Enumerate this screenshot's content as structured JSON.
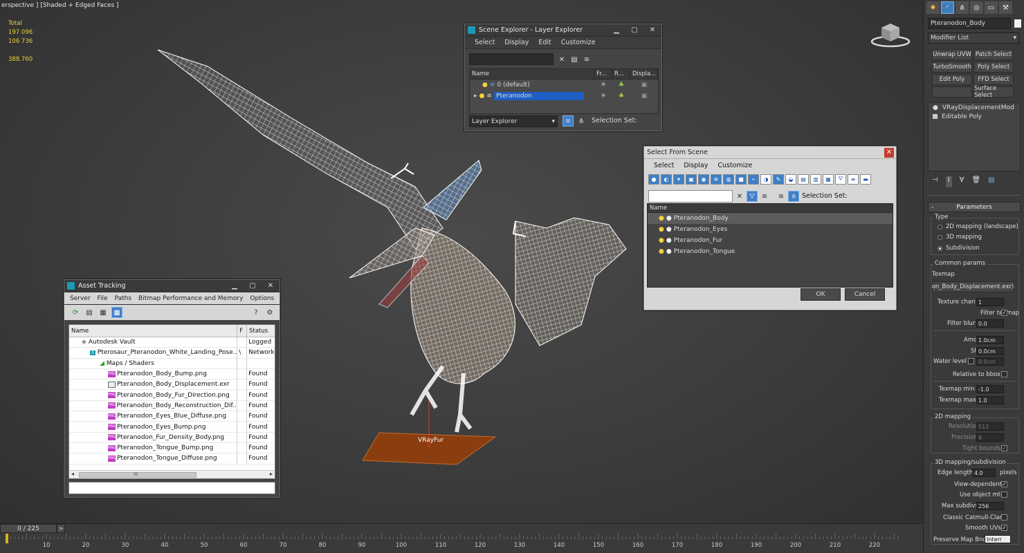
{
  "viewport": {
    "label": "erspective ] [Shaded + Edged Faces ]",
    "stats": {
      "total_label": "Total",
      "polys": "197 096",
      "verts": "106 736",
      "fps": "388.760"
    },
    "object_label": "VRayFur"
  },
  "scene_explorer": {
    "title": "Scene Explorer - Layer Explorer",
    "menu": [
      "Select",
      "Display",
      "Edit",
      "Customize"
    ],
    "columns": [
      "Name",
      "Fr...",
      "R...",
      "Displa..."
    ],
    "rows": [
      "0 (default)",
      "Pteranodon"
    ],
    "footer_dropdown": "Layer Explorer",
    "selection_set_label": "Selection Set:"
  },
  "select_from_scene": {
    "title": "Select From Scene",
    "menu": [
      "Select",
      "Display",
      "Customize"
    ],
    "selection_set_label": "Selection Set:",
    "column": "Name",
    "rows": [
      "Pteranodon_Body",
      "Pteranodon_Eyes",
      "Pteranodon_Fur",
      "Pteranodon_Tongue"
    ],
    "ok": "OK",
    "cancel": "Cancel"
  },
  "asset_tracking": {
    "title": "Asset Tracking",
    "menu": [
      "Server",
      "File",
      "Paths",
      "Bitmap Performance and Memory",
      "Options"
    ],
    "columns": [
      "Name",
      "F",
      "Status"
    ],
    "rows": [
      {
        "name": "Autodesk Vault",
        "f": "",
        "status": "Logged",
        "kind": "vault"
      },
      {
        "name": "Pterosaur_Pteranodon_White_Landing_Pose...",
        "f": "\\",
        "status": "Network",
        "kind": "max"
      },
      {
        "name": "Maps / Shaders",
        "f": "",
        "status": "",
        "kind": "maps"
      },
      {
        "name": "Pteranodon_Body_Bump.png",
        "f": "",
        "status": "Found",
        "kind": "png"
      },
      {
        "name": "Pteranodon_Body_Displacement.exr",
        "f": "",
        "status": "Found",
        "kind": "exr"
      },
      {
        "name": "Pteranodon_Body_Fur_Direction.png",
        "f": "",
        "status": "Found",
        "kind": "png"
      },
      {
        "name": "Pteranodon_Body_Reconstruction_Dif...",
        "f": "",
        "status": "Found",
        "kind": "png"
      },
      {
        "name": "Pteranodon_Eyes_Blue_Diffuse.png",
        "f": "",
        "status": "Found",
        "kind": "png"
      },
      {
        "name": "Pteranodon_Eyes_Bump.png",
        "f": "",
        "status": "Found",
        "kind": "png"
      },
      {
        "name": "Pteranodon_Fur_Density_Body.png",
        "f": "",
        "status": "Found",
        "kind": "png"
      },
      {
        "name": "Pteranodon_Tongue_Bump.png",
        "f": "",
        "status": "Found",
        "kind": "png"
      },
      {
        "name": "Pteranodon_Tongue_Diffuse.png",
        "f": "",
        "status": "Found",
        "kind": "png"
      }
    ],
    "scroll_grip": "III"
  },
  "command_panel": {
    "object_name": "Pteranodon_Body",
    "modifier_list": "Modifier List",
    "modifier_buttons": [
      "Unwrap UVW",
      "Patch Select",
      "TurboSmooth",
      "Poly Select",
      "Edit Poly",
      "FFD Select",
      "",
      "Surface Select"
    ],
    "stack": [
      "VRayDisplacementMod",
      "Editable Poly"
    ],
    "rollout": "Parameters",
    "type_group": "Type",
    "type_options": [
      "2D mapping (landscape)",
      "3D mapping",
      "Subdivision"
    ],
    "type_selected": 2,
    "common_params": "Common params",
    "texmap_label": "Texmap",
    "texmap_value": "on_Body_Displacement.exr)",
    "texture_chan": {
      "label": "Texture chan",
      "value": "1"
    },
    "filter_texmap": {
      "label": "Filter texmap",
      "checked": true
    },
    "filter_blur": {
      "label": "Filter blur",
      "value": "0.0"
    },
    "amount": {
      "label": "Amount",
      "value": "1.0cm"
    },
    "shift": {
      "label": "Shift",
      "value": "0.0cm"
    },
    "water_level": {
      "label": "Water level",
      "value": "0.0cm"
    },
    "relative_to_bbox": {
      "label": "Relative to bbox"
    },
    "texmap_min": {
      "label": "Texmap min",
      "value": "-1.0"
    },
    "texmap_max": {
      "label": "Texmap max",
      "value": "1.0"
    },
    "mapping_2d": "2D mapping",
    "resolution": {
      "label": "Resolution",
      "value": "512"
    },
    "precision": {
      "label": "Precision",
      "value": "8"
    },
    "tight_bounds": {
      "label": "Tight bounds"
    },
    "mapping_3d": "3D mapping/subdivision",
    "edge_length": {
      "label": "Edge length",
      "value": "4.0",
      "unit": "pixels"
    },
    "view_dependent": {
      "label": "View-dependent"
    },
    "use_object_mtl": {
      "label": "Use object mtl"
    },
    "max_subdivs": {
      "label": "Max subdivs",
      "value": "256"
    },
    "classic_cc": {
      "label": "Classic Catmull-Clark"
    },
    "smooth_uvs": {
      "label": "Smooth UVs"
    },
    "preserve_map_bnd": {
      "label": "Preserve Map Bnd",
      "value": "Interr"
    }
  },
  "timeline": {
    "frame": "0 / 225",
    "next": ">",
    "ticks": [
      "10",
      "20",
      "30",
      "40",
      "50",
      "60",
      "70",
      "80",
      "90",
      "100",
      "110",
      "120",
      "130",
      "140",
      "150",
      "160",
      "170",
      "180",
      "190",
      "200",
      "210",
      "220"
    ]
  }
}
